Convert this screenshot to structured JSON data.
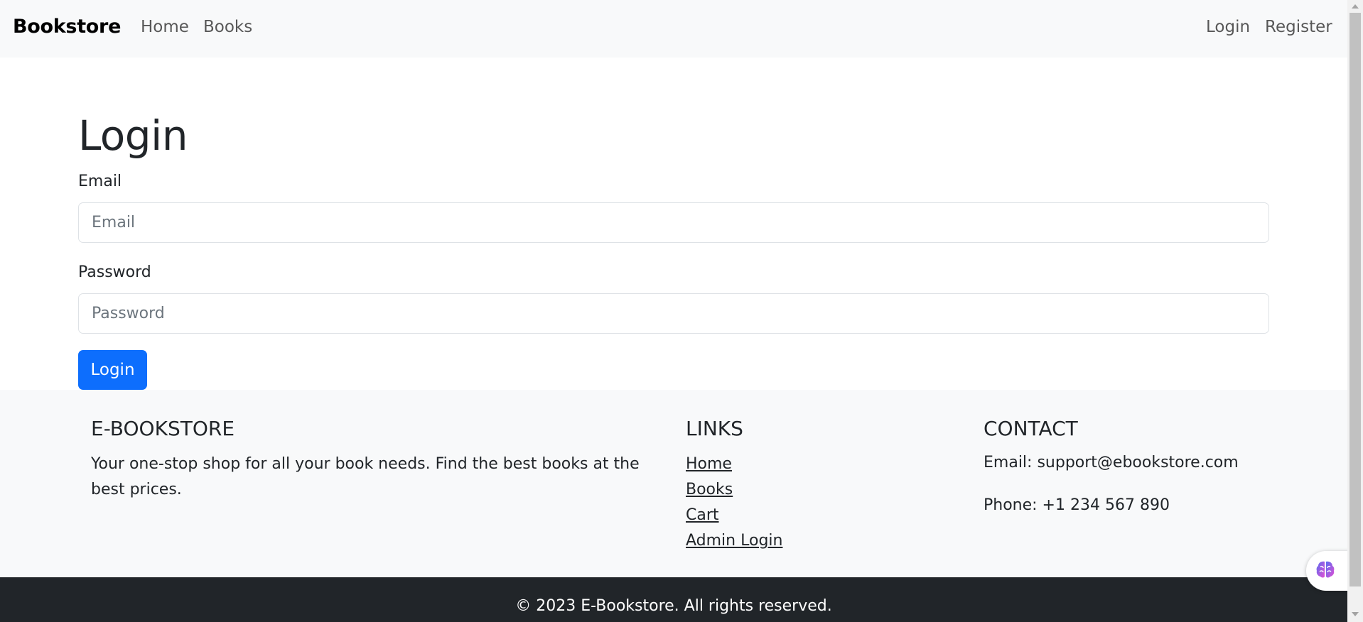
{
  "navbar": {
    "brand": "Bookstore",
    "links": [
      "Home",
      "Books"
    ],
    "auth_links": [
      "Login",
      "Register"
    ]
  },
  "login_form": {
    "title": "Login",
    "email_label": "Email",
    "email_placeholder": "Email",
    "email_value": "",
    "password_label": "Password",
    "password_placeholder": "Password",
    "password_value": "",
    "submit_label": "Login"
  },
  "footer": {
    "about": {
      "heading": "E-BOOKSTORE",
      "text": "Your one-stop shop for all your book needs. Find the best books at the best prices."
    },
    "links": {
      "heading": "LINKS",
      "items": [
        "Home",
        "Books",
        "Cart",
        "Admin Login"
      ]
    },
    "contact": {
      "heading": "CONTACT",
      "email": "Email: support@ebookstore.com",
      "phone": "Phone: +1 234 567 890"
    },
    "copyright": "© 2023 E-Bookstore. All rights reserved."
  },
  "widget": {
    "icon": "brain-icon"
  },
  "colors": {
    "primary": "#0d6efd",
    "light_bg": "#f8f9fa",
    "dark_bg": "#212529",
    "text": "#212529"
  }
}
